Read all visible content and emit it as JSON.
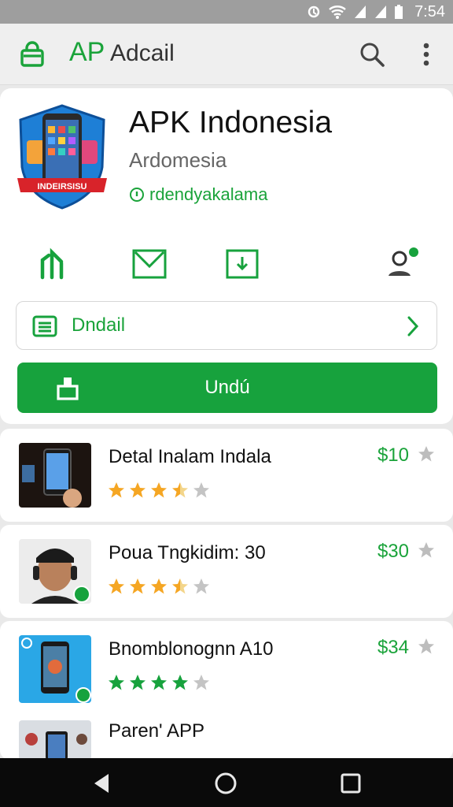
{
  "status_bar": {
    "time": "7:54"
  },
  "app_bar": {
    "title_prefix": "AP",
    "title_rest": " Adcail"
  },
  "app": {
    "name": "APK Indonesia",
    "developer": "Ardomesia",
    "author": "rdendyakalama",
    "icon_banner": "INDEIRSISU"
  },
  "details_row": {
    "label": "Dndail"
  },
  "install_button": {
    "label": "Undú"
  },
  "list": [
    {
      "title": "Detal Inalam Indala",
      "price": "$10",
      "rating": 3.5
    },
    {
      "title": "Poua Tngkidim: 30",
      "price": "$30",
      "rating": 3.5
    },
    {
      "title": "Bnomblonognn A10",
      "price": "$34",
      "rating": 4
    },
    {
      "title": "Paren' APP",
      "price": "",
      "rating": null
    }
  ],
  "colors": {
    "accent": "#17a23d",
    "star": "#f5a623",
    "star_empty": "#c4c4c4"
  }
}
